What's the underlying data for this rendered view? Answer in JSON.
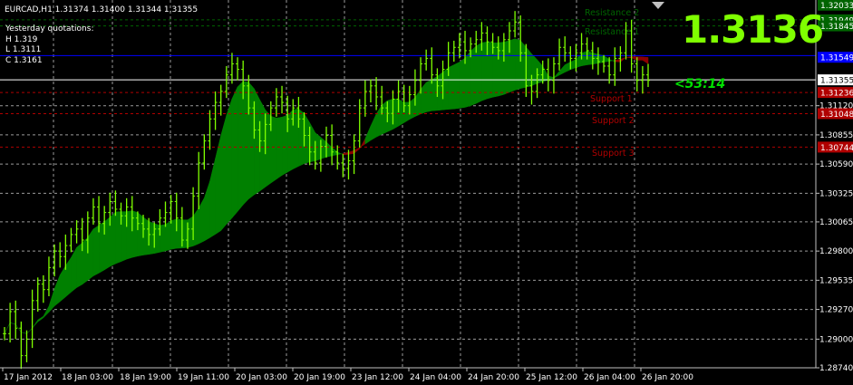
{
  "header": {
    "ohlc_text": "EURCAD,H1  1.31374 1.31400 1.31344 1.31355"
  },
  "yesterday": {
    "title": "Yesterday quotations:",
    "high": "H 1.319",
    "low": "L 1.3111",
    "close": "C 1.3161"
  },
  "big_price": "1.3136",
  "bar_timer": "<53:14",
  "levels": [
    {
      "name": "Resistance 2",
      "color": "#006400"
    },
    {
      "name": "Resistance 1",
      "color": "#006400"
    },
    {
      "name": "Support 1",
      "color": "#b00000"
    },
    {
      "name": "Support 2",
      "color": "#b00000"
    },
    {
      "name": "Support 3",
      "color": "#b00000"
    }
  ],
  "chart_data": {
    "type": "line",
    "symbol": "EURCAD",
    "timeframe": "H1",
    "price_axis": {
      "ylim": [
        1.2874,
        1.3208
      ],
      "ticks": [
        1.2874,
        1.29,
        1.2927,
        1.29535,
        1.298,
        1.30065,
        1.30325,
        1.3059,
        1.30855,
        1.3112
      ]
    },
    "price_labels": [
      {
        "text": "1.32033",
        "value": 1.32033,
        "bg": "#006400",
        "fg": "#ffffff"
      },
      {
        "text": "1.31949",
        "value": 1.319,
        "bg": "#006400",
        "fg": "#ffffff"
      },
      {
        "text": "1.31845",
        "value": 1.31845,
        "bg": "#006400",
        "fg": "#ffffff"
      },
      {
        "text": "1.31549",
        "value": 1.3156,
        "bg": "#0000ff",
        "fg": "#ffffff"
      },
      {
        "text": "1.31355",
        "value": 1.31355,
        "bg": "#ffffff",
        "fg": "#000000"
      },
      {
        "text": "1.31236",
        "value": 1.3124,
        "bg": "#b00000",
        "fg": "#ffffff"
      },
      {
        "text": "1.31048",
        "value": 1.31048,
        "bg": "#b00000",
        "fg": "#ffffff"
      },
      {
        "text": "1.30744",
        "value": 1.30744,
        "bg": "#b00000",
        "fg": "#ffffff"
      }
    ],
    "time_axis": [
      "17 Jan 2012",
      "18 Jan 03:00",
      "18 Jan 19:00",
      "19 Jan 11:00",
      "20 Jan 03:00",
      "20 Jan 19:00",
      "23 Jan 12:00",
      "24 Jan 04:00",
      "24 Jan 20:00",
      "25 Jan 12:00",
      "26 Jan 04:00",
      "26 Jan 20:00"
    ],
    "horizontal_lines": [
      {
        "value": 1.319,
        "color": "#006400",
        "style": "dashed"
      },
      {
        "value": 1.31845,
        "color": "#006400",
        "style": "dashed"
      },
      {
        "value": 1.31575,
        "color": "#0000ff",
        "style": "solid"
      },
      {
        "value": 1.31355,
        "color": "#ffffff",
        "style": "solid"
      },
      {
        "value": 1.3124,
        "color": "#b00000",
        "style": "dashed"
      },
      {
        "value": 1.31048,
        "color": "#b00000",
        "style": "dashed"
      },
      {
        "value": 1.30744,
        "color": "#b00000",
        "style": "dashed"
      }
    ],
    "close_series": [
      1.2905,
      1.2925,
      1.291,
      1.2885,
      1.29,
      1.2935,
      1.295,
      1.2945,
      1.2965,
      1.298,
      1.2975,
      1.2985,
      1.2995,
      1.3,
      1.299,
      1.301,
      1.302,
      1.3005,
      1.3015,
      1.3025,
      1.3018,
      1.3012,
      1.302,
      1.301,
      1.3005,
      1.3,
      1.2995,
      1.3,
      1.301,
      1.3015,
      1.3025,
      1.301,
      1.299,
      1.3,
      1.303,
      1.306,
      1.308,
      1.31,
      1.3115,
      1.3125,
      1.314,
      1.315,
      1.3145,
      1.313,
      1.311,
      1.309,
      1.308,
      1.3095,
      1.311,
      1.312,
      1.3115,
      1.31,
      1.311,
      1.31,
      1.3085,
      1.307,
      1.306,
      1.3075,
      1.3085,
      1.307,
      1.306,
      1.3055,
      1.3062,
      1.308,
      1.311,
      1.3125,
      1.313,
      1.312,
      1.311,
      1.3105,
      1.3118,
      1.3125,
      1.3112,
      1.3122,
      1.3135,
      1.315,
      1.3155,
      1.314,
      1.313,
      1.3145,
      1.316,
      1.3165,
      1.317,
      1.3162,
      1.3168,
      1.3172,
      1.3178,
      1.317,
      1.3165,
      1.3162,
      1.3172,
      1.318,
      1.3188,
      1.316,
      1.313,
      1.3125,
      1.314,
      1.3145,
      1.3135,
      1.315,
      1.3165,
      1.316,
      1.3155,
      1.316,
      1.3168,
      1.3162,
      1.3155,
      1.3152,
      1.3148,
      1.314,
      1.3155,
      1.316,
      1.318,
      1.315,
      1.3135,
      1.314,
      1.3135
    ]
  }
}
